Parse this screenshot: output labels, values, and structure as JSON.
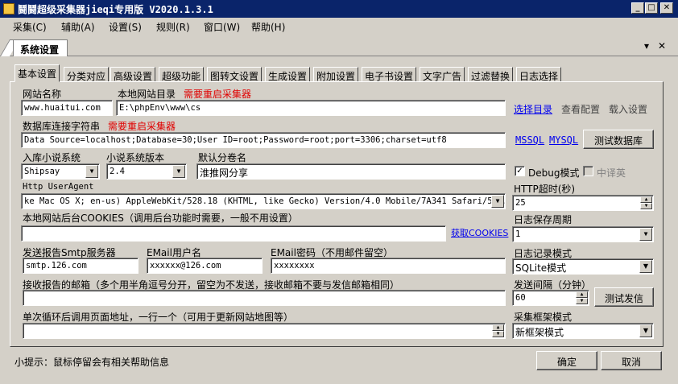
{
  "window": {
    "title": "鬪鬪超级采集器jieqi专用版 V2020.1.3.1",
    "min": "_",
    "max": "□",
    "close": "✕"
  },
  "menu": [
    "采集(C)",
    "辅助(A)",
    "设置(S)",
    "规则(R)",
    "窗口(W)",
    "帮助(H)"
  ],
  "doc_tab": {
    "label": "系统设置",
    "dropdown": "▾",
    "close": "✕"
  },
  "tabs": [
    "基本设置",
    "分类对应",
    "高级设置",
    "超级功能",
    "图转文设置",
    "生成设置",
    "附加设置",
    "电子书设置",
    "文字广告",
    "过滤替换",
    "日志选择"
  ],
  "form": {
    "site_name_label": "网站名称",
    "site_name_value": "www.huaitui.com",
    "local_dir_label": "本地网站目录",
    "local_dir_note": "需要重启采集器",
    "local_dir_value": "E:\\phpEnv\\www\\cs",
    "choose_dir": "选择目录",
    "view_config": "查看配置",
    "load_settings": "载入设置",
    "db_conn_label": "数据库连接字符串",
    "db_conn_note": "需要重启采集器",
    "db_conn_value": "Data Source=localhost;Database=30;User ID=root;Password=root;port=3306;charset=utf8",
    "mssql": "MSSQL",
    "mysql": "MYSQL",
    "test_db": "测试数据库",
    "novel_system_label": "入库小说系统",
    "novel_system_value": "Shipsay",
    "novel_version_label": "小说系统版本",
    "novel_version_value": "2.4",
    "default_volume_label": "默认分卷名",
    "default_volume_value": "淮推网分享",
    "debug_label": "Debug模式",
    "debug_checked": "✓",
    "zh_en_label": "中译英",
    "ua_label": "Http UserAgent",
    "ua_value": "ke Mac OS X; en-us) AppleWebKit/528.18 (KHTML, like Gecko) Version/4.0 Mobile/7A341 Safari/528.16",
    "http_timeout_label": "HTTP超时(秒)",
    "http_timeout_value": "25",
    "cookies_label": "本地网站后台COOKIES（调用后台功能时需要，一般不用设置）",
    "cookies_value": "",
    "get_cookies": "获取COOKIES",
    "log_keep_label": "日志保存周期",
    "log_keep_value": "1",
    "smtp_label": "发送报告Smtp服务器",
    "smtp_value": "smtp.126.com",
    "email_user_label": "EMail用户名",
    "email_user_value": "xxxxxx@126.com",
    "email_pass_label": "EMail密码（不用邮件留空）",
    "email_pass_value": "xxxxxxxx",
    "log_mode_label": "日志记录模式",
    "log_mode_value": "SQLite模式",
    "recv_mail_label": "接收报告的邮箱（多个用半角逗号分开，留空为不发送，接收邮箱不要与发信邮箱相同）",
    "recv_mail_value": "",
    "send_interval_label": "发送间隔（分钟）",
    "send_interval_value": "60",
    "test_send": "测试发信",
    "loop_url_label": "单次循环后调用页面地址，一行一个（可用于更新网站地图等）",
    "loop_url_value": "",
    "frame_mode_label": "采集框架模式",
    "frame_mode_value": "新框架模式"
  },
  "footer": {
    "tip": "小提示：鼠标停留会有相关帮助信息",
    "ok": "确定",
    "cancel": "取消"
  },
  "icons": {
    "combo_arrow": "▼",
    "spin_up": "▲",
    "spin_down": "▼"
  }
}
